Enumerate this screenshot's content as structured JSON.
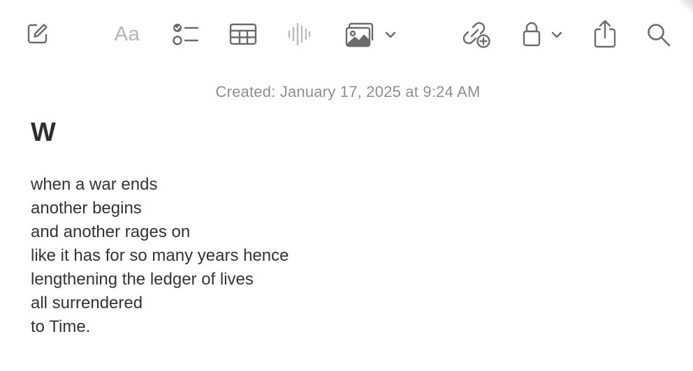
{
  "toolbar": {
    "compose_icon": "compose-icon",
    "format_label": "Aa",
    "checklist_icon": "checklist-icon",
    "table_icon": "table-icon",
    "audio_icon": "waveform-icon",
    "media_icon": "photo-library-icon",
    "media_menu_icon": "chevron-down-icon",
    "collab_icon": "link-add-icon",
    "lock_icon": "lock-icon",
    "lock_menu_icon": "chevron-down-icon",
    "share_icon": "share-icon",
    "search_icon": "search-icon",
    "icon_color": "#6b6b6b",
    "disabled_color": "#b9b9b9"
  },
  "note": {
    "created": "Created: January 17, 2025 at 9:24 AM",
    "title": "W",
    "lines": [
      "when a war ends",
      "another begins",
      "and another rages on",
      "like it has for so many years hence",
      "lengthening the ledger of lives",
      "all surrendered",
      "to Time."
    ]
  }
}
